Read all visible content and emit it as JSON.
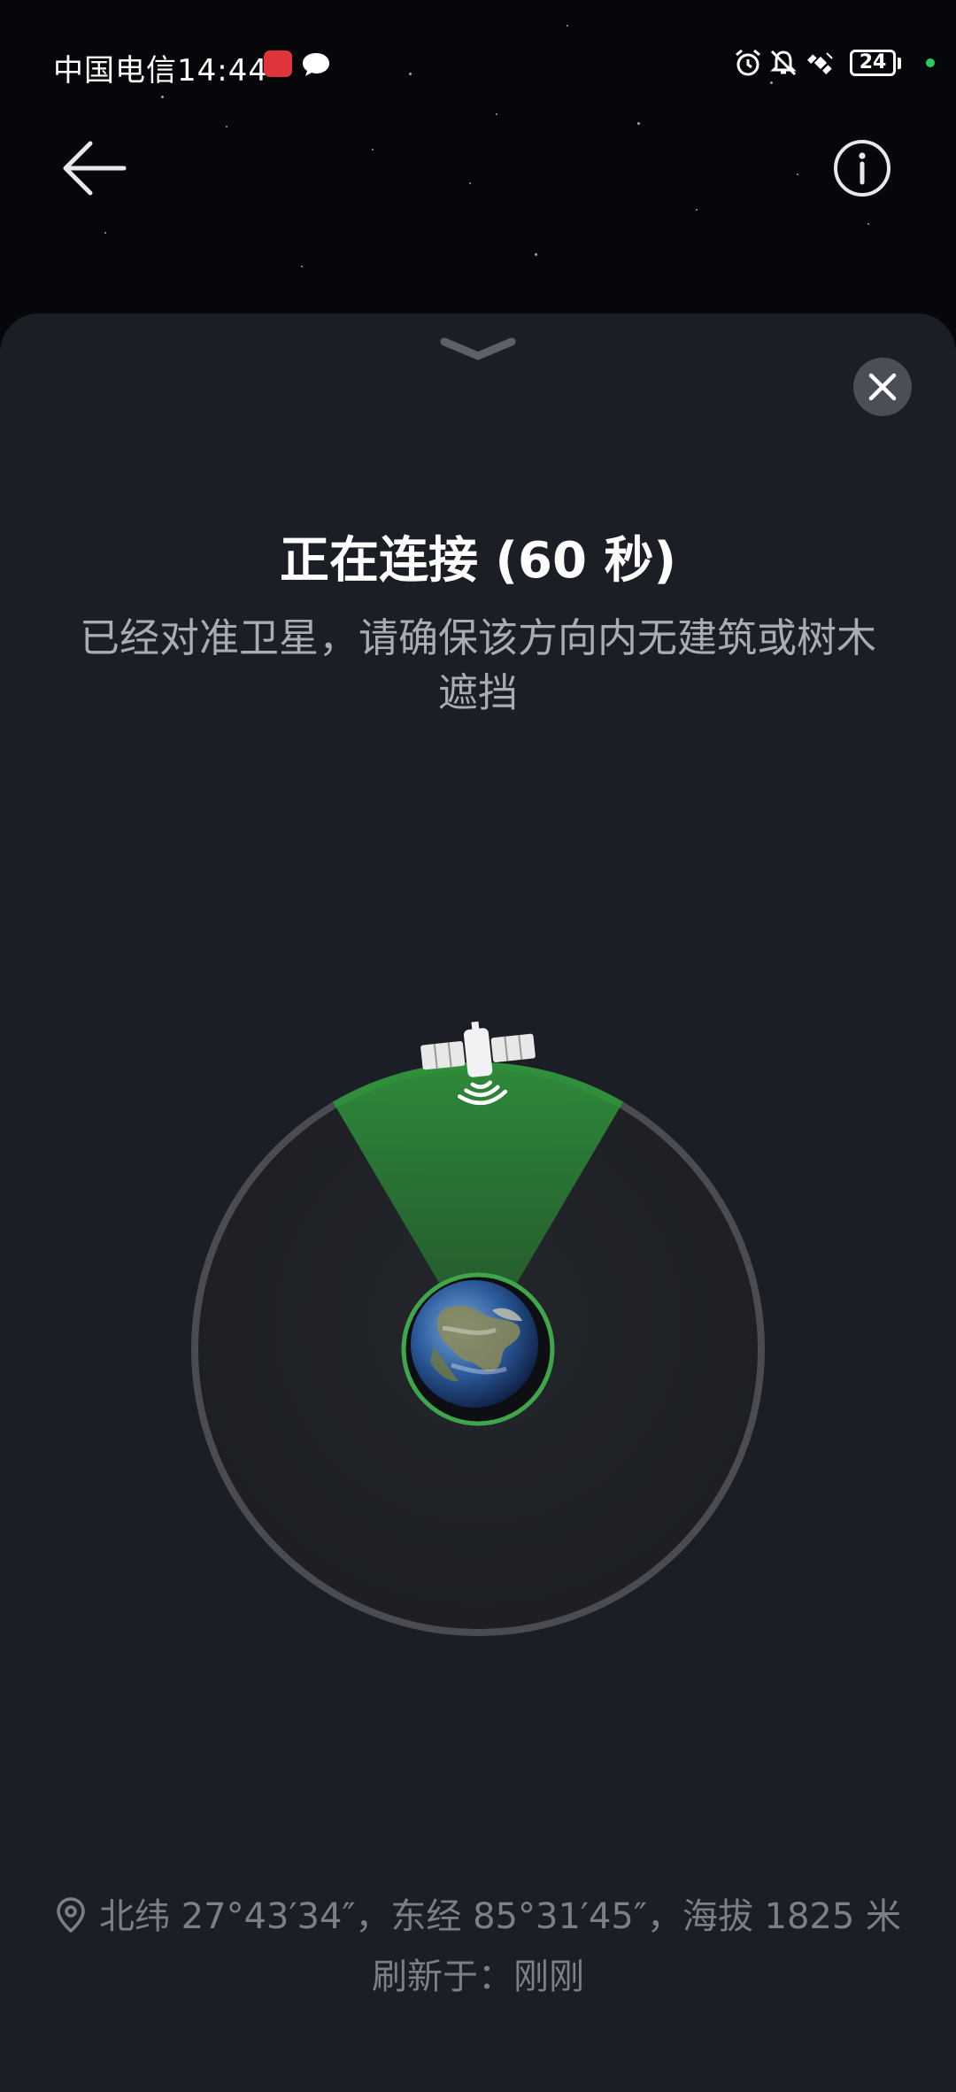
{
  "status_bar": {
    "carrier": "中国电信",
    "time": "14:44",
    "battery": "24"
  },
  "colors": {
    "accent_green": "#2f8f3b",
    "sheet_bg": "#1b1e25",
    "ring": "#4a4c51"
  },
  "icons": {
    "back": "arrow-left-icon",
    "info": "info-icon",
    "close": "close-icon",
    "handle": "chevron-down-icon",
    "location": "location-pin-icon",
    "satellite": "satellite-icon"
  },
  "connection": {
    "title": "正在连接 (60 秒)",
    "subtitle": "已经对准卫星，请确保该方向内无建筑或树木遮挡"
  },
  "location": {
    "text": "北纬 27°43′34″，东经 85°31′45″，海拔 1825 米",
    "refresh": "刷新于：刚刚"
  }
}
